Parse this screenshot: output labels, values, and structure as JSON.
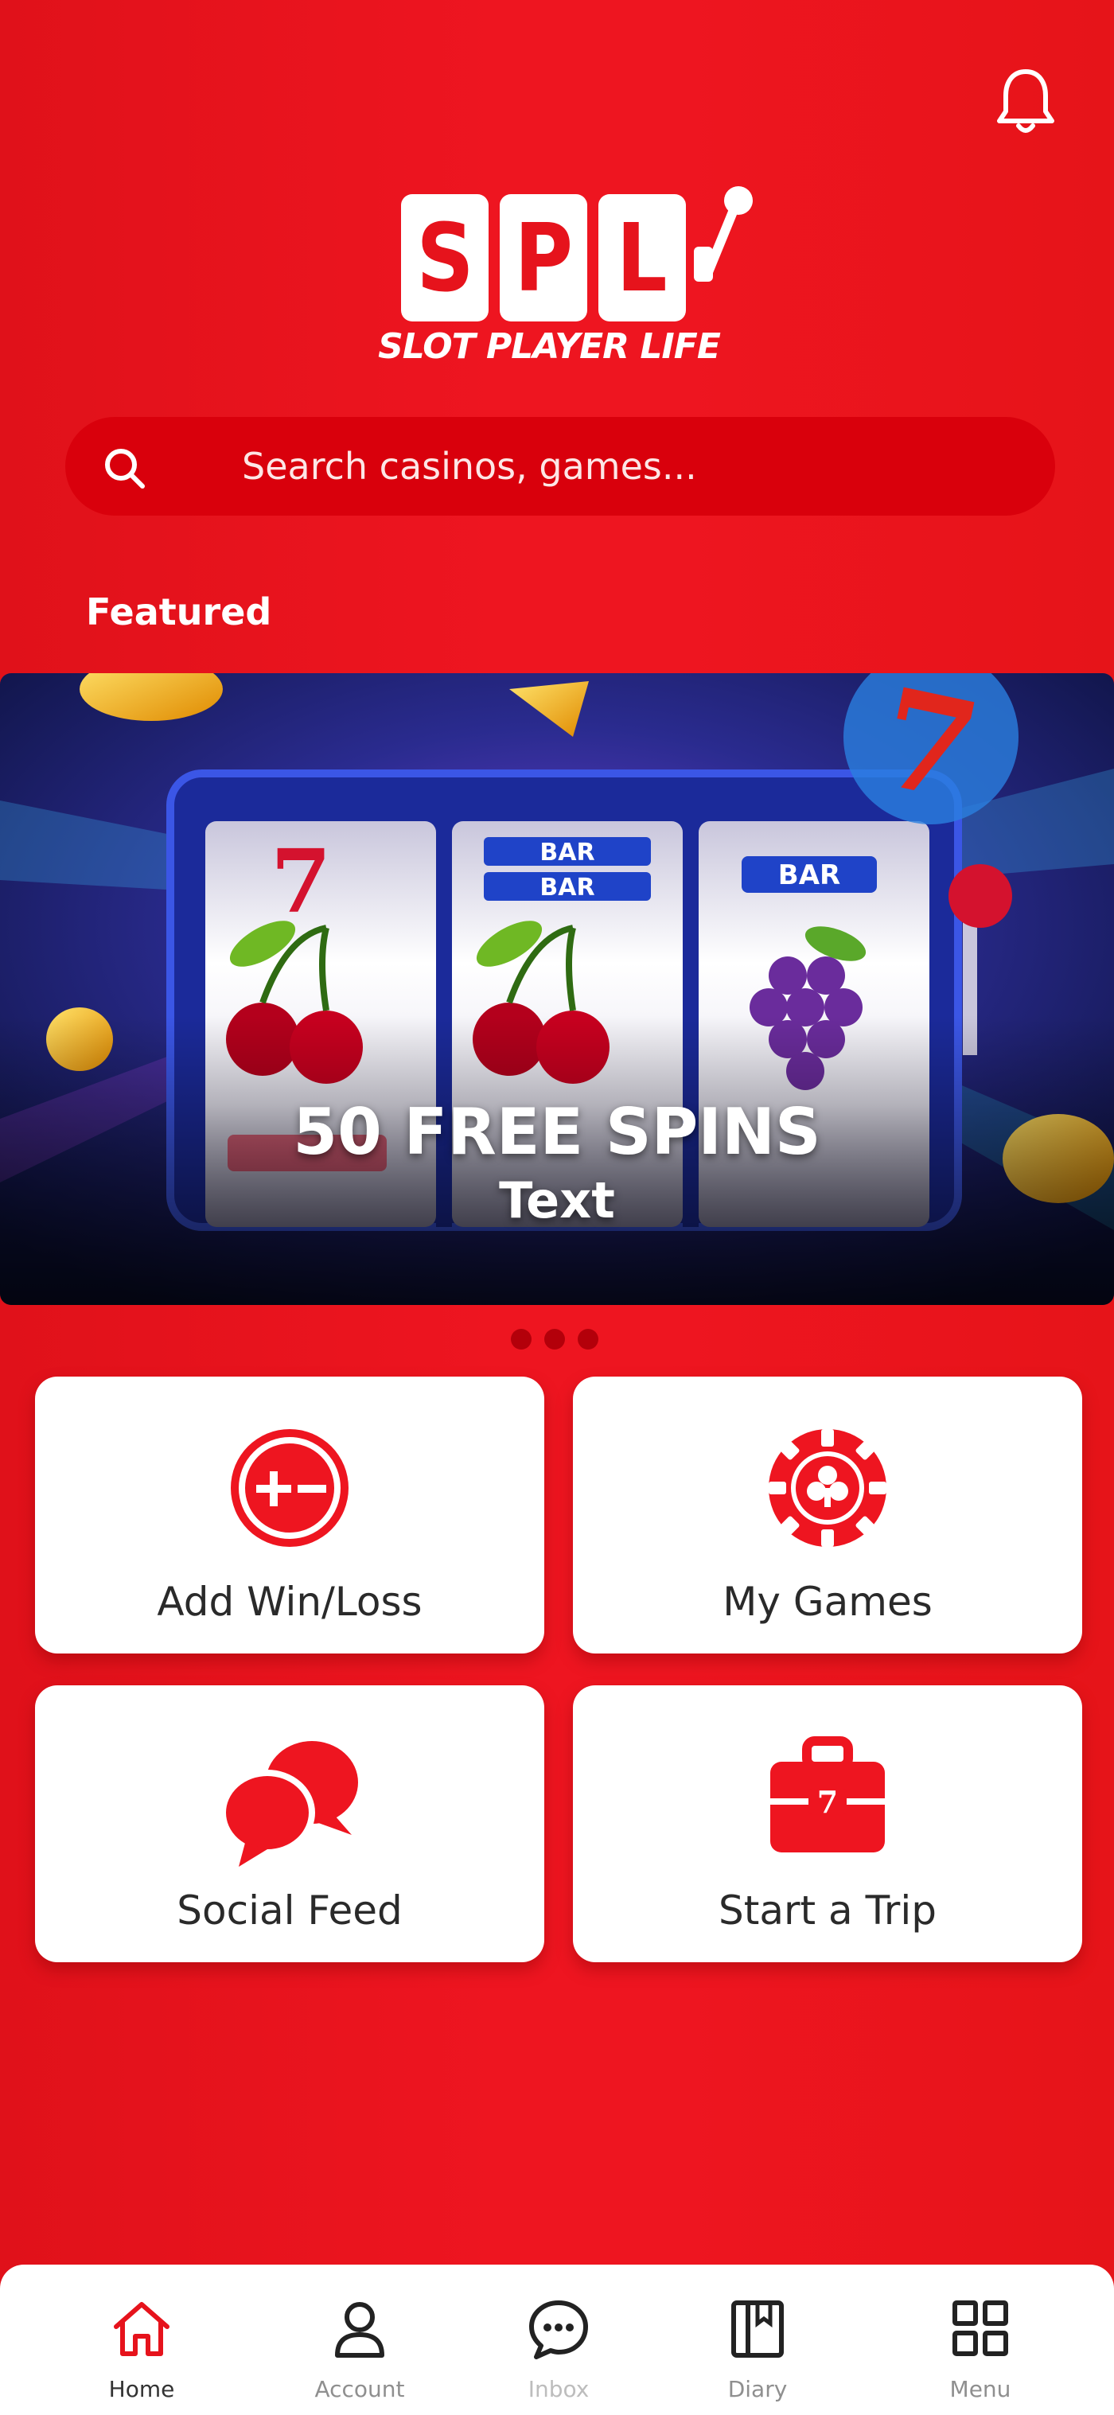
{
  "header": {
    "notification_icon": "bell-icon",
    "logo": {
      "letters": [
        "S",
        "P",
        "L"
      ],
      "tagline": "SLOT PLAYER LIFE"
    }
  },
  "search": {
    "placeholder": "Search casinos, games...",
    "value": "",
    "icon": "search-icon"
  },
  "featured": {
    "title": "Featured",
    "banner": {
      "headline": "50 FREE SPINS",
      "subtitle": "Text"
    },
    "carousel_pages": 3
  },
  "actions": [
    {
      "label": "Add Win/Loss",
      "icon": "plus-minus-icon"
    },
    {
      "label": "My Games",
      "icon": "poker-chip-icon"
    },
    {
      "label": "Social Feed",
      "icon": "chat-bubbles-icon"
    },
    {
      "label": "Start a Trip",
      "icon": "suitcase-icon"
    }
  ],
  "tabbar": {
    "active": "Home",
    "tabs": [
      {
        "label": "Home",
        "icon": "home-icon"
      },
      {
        "label": "Account",
        "icon": "user-icon"
      },
      {
        "label": "Inbox",
        "icon": "chat-icon"
      },
      {
        "label": "Diary",
        "icon": "book-icon"
      },
      {
        "label": "Menu",
        "icon": "grid-icon"
      }
    ]
  },
  "colors": {
    "primary": "#EE1520",
    "search_bg": "#D9000C",
    "card_bg": "#FFFFFF",
    "text_dark": "#2A2A2A"
  }
}
